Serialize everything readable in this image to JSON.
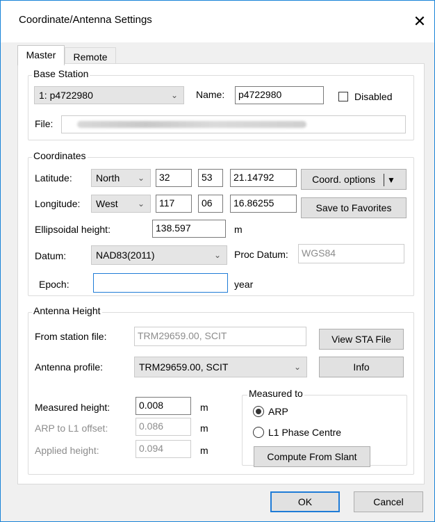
{
  "window": {
    "title": "Coordinate/Antenna Settings",
    "close": "✕"
  },
  "tabs": [
    {
      "label": "Master",
      "active": true
    },
    {
      "label": "Remote",
      "active": false
    }
  ],
  "base_station": {
    "group_title": "Base Station",
    "station_select": "1: p4722980",
    "name_label": "Name:",
    "name_value": "p4722980",
    "disabled_label": "Disabled",
    "disabled_checked": false,
    "file_label": "File:"
  },
  "coordinates": {
    "group_title": "Coordinates",
    "latitude_label": "Latitude:",
    "lat_hemisphere": "North",
    "lat_deg": "32",
    "lat_min": "53",
    "lat_sec": "21.14792",
    "coord_options_label": "Coord. options",
    "longitude_label": "Longitude:",
    "lon_hemisphere": "West",
    "lon_deg": "117",
    "lon_min": "06",
    "lon_sec": "16.86255",
    "save_favorites_label": "Save to Favorites",
    "ellipsoidal_label": "Ellipsoidal height:",
    "ellipsoidal_value": "138.597",
    "ellipsoidal_unit": "m",
    "datum_label": "Datum:",
    "datum_value": "NAD83(2011)",
    "proc_datum_label": "Proc Datum:",
    "proc_datum_value": "WGS84",
    "epoch_label": "Epoch:",
    "epoch_value": "",
    "epoch_unit": "year"
  },
  "antenna": {
    "group_title": "Antenna Height",
    "from_station_label": "From station file:",
    "from_station_value": "TRM29659.00, SCIT",
    "view_sta_label": "View STA File",
    "profile_label": "Antenna profile:",
    "profile_value": "TRM29659.00, SCIT",
    "info_label": "Info",
    "measured_height_label": "Measured height:",
    "measured_height_value": "0.008",
    "arp_offset_label": "ARP to L1 offset:",
    "arp_offset_value": "0.086",
    "applied_height_label": "Applied height:",
    "applied_height_value": "0.094",
    "unit": "m",
    "measured_to": {
      "group_title": "Measured to",
      "option_arp": "ARP",
      "option_l1": "L1 Phase Centre",
      "selected": "ARP",
      "compute_label": "Compute From Slant"
    }
  },
  "footer": {
    "ok_label": "OK",
    "cancel_label": "Cancel"
  }
}
